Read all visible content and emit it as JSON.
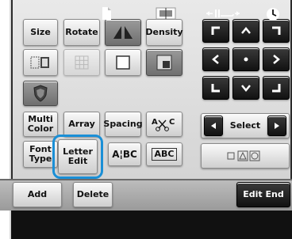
{
  "edit_screen": {
    "size_label": "Size",
    "rotate_label": "Rotate",
    "density_label": "Density",
    "multi_color_label": "Multi\nColor",
    "array_label": "Array",
    "spacing_label": "Spacing",
    "font_type_label": "Font\nType",
    "letter_edit_label": "Letter\nEdit",
    "abc_split_label": "A¦BC",
    "abc_box_label": "ABC",
    "select_label": "Select",
    "add_label": "Add",
    "delete_label": "Delete",
    "edit_end_label": "Edit End",
    "highlight_color": "#1a8fd6"
  }
}
